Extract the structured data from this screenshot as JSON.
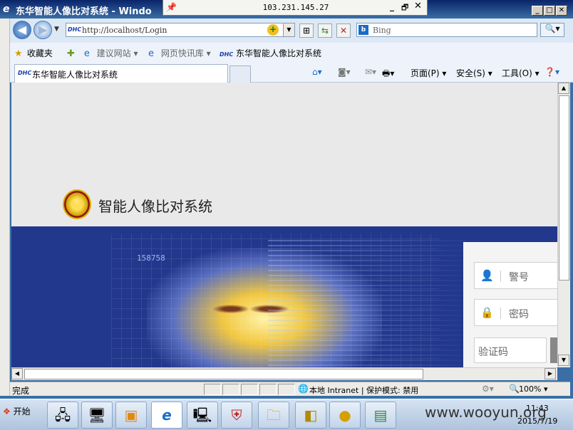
{
  "window": {
    "title": "东华智能人像比对系统 - Windo",
    "rdp_host": "103.231.145.27",
    "rdp_min": "_",
    "rdp_max": "🗗",
    "rdp_close": "✕",
    "min": "_",
    "max": "□",
    "close": "✕"
  },
  "address_bar": {
    "site_badge": "DHC",
    "url": "http://localhost/Login"
  },
  "search": {
    "provider_badge": "b",
    "placeholder": "Bing"
  },
  "favorites_bar": {
    "favorites_label": "收藏夹",
    "items": [
      {
        "label": "建议网站 ▾"
      },
      {
        "label": "网页快讯库 ▾"
      },
      {
        "badge": "DHC",
        "label": "东华智能人像比对系统"
      }
    ]
  },
  "tab": {
    "badge": "DHC",
    "label": "东华智能人像比对系统"
  },
  "command_bar": {
    "page": "页面(P) ▾",
    "safety": "安全(S) ▾",
    "tools": "工具(O) ▾"
  },
  "page": {
    "site_title": "智能人像比对系统",
    "banner_digits": "158758",
    "login": {
      "badge_placeholder": "警号",
      "password_placeholder": "密码",
      "captcha_placeholder": "验证码"
    }
  },
  "status_bar": {
    "status": "完成",
    "zone": "本地 Intranet | 保护模式: 禁用",
    "zoom": "100% ▾"
  },
  "taskbar": {
    "start_label": "开始",
    "clock_time": "11:43",
    "clock_date": "2015/7/19",
    "watermark": "www.wooyun.org"
  },
  "colors": {
    "banner": "#22388c",
    "page_header": "#e9e9ea",
    "titlebar": "#0a246a"
  }
}
